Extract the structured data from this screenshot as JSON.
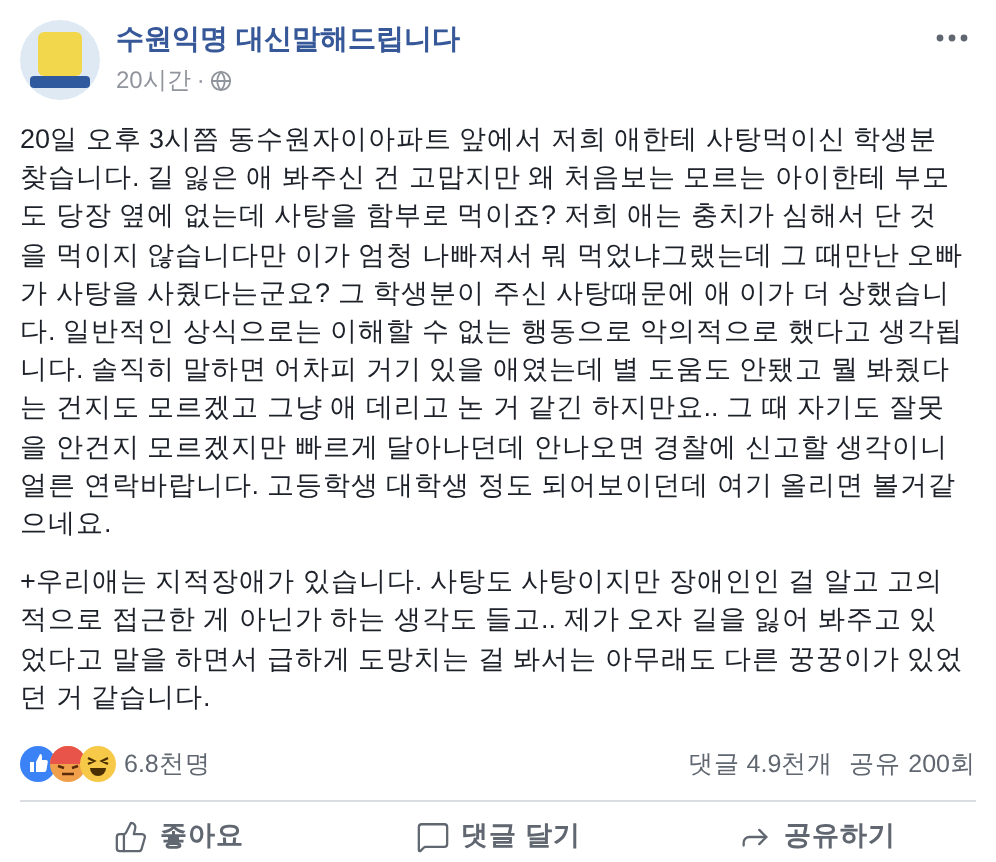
{
  "post": {
    "author": "수원익명 대신말해드립니다",
    "time": "20시간",
    "separator": "·",
    "paragraphs": [
      "20일 오후 3시쯤 동수원자이아파트 앞에서 저희 애한테 사탕먹이신 학생분 찾습니다. 길 잃은 애 봐주신 건 고맙지만 왜 처음보는 모르는 아이한테 부모도 당장 옆에 없는데 사탕을 함부로 먹이죠? 저희 애는 충치가 심해서 단 것을 먹이지 않습니다만 이가 엄청 나빠져서 뭐 먹었냐그랬는데 그 때만난 오빠가 사탕을 사줬다는군요? 그 학생분이 주신 사탕때문에 애 이가 더 상했습니다. 일반적인 상식으로는 이해할 수 없는 행동으로 악의적으로 했다고 생각됩니다. 솔직히 말하면 어차피 거기 있을 애였는데 별 도움도 안됐고 뭘 봐줬다는 건지도 모르겠고 그냥 애 데리고 논 거 같긴 하지만요.. 그 때 자기도 잘못을 안건지 모르겠지만 빠르게 달아나던데 안나오면 경찰에 신고할 생각이니 얼른 연락바랍니다. 고등학생 대학생 정도 되어보이던데 여기 올리면 볼거같으네요.",
      "+우리애는 지적장애가 있습니다. 사탕도 사탕이지만 장애인인 걸 알고 고의적으로 접근한 게 아닌가 하는 생각도 들고.. 제가 오자 길을 잃어 봐주고 있었다고 말을 하면서 급하게 도망치는 걸 봐서는 아무래도 다른 꿍꿍이가 있었던 거 같습니다."
    ]
  },
  "reactions": {
    "count": "6.8천명",
    "comments": "댓글 4.9천개",
    "shares": "공유 200회"
  },
  "actions": [
    {
      "kind": "like",
      "label": "좋아요"
    },
    {
      "kind": "comment",
      "label": "댓글 달기"
    },
    {
      "kind": "share",
      "label": "공유하기"
    }
  ]
}
